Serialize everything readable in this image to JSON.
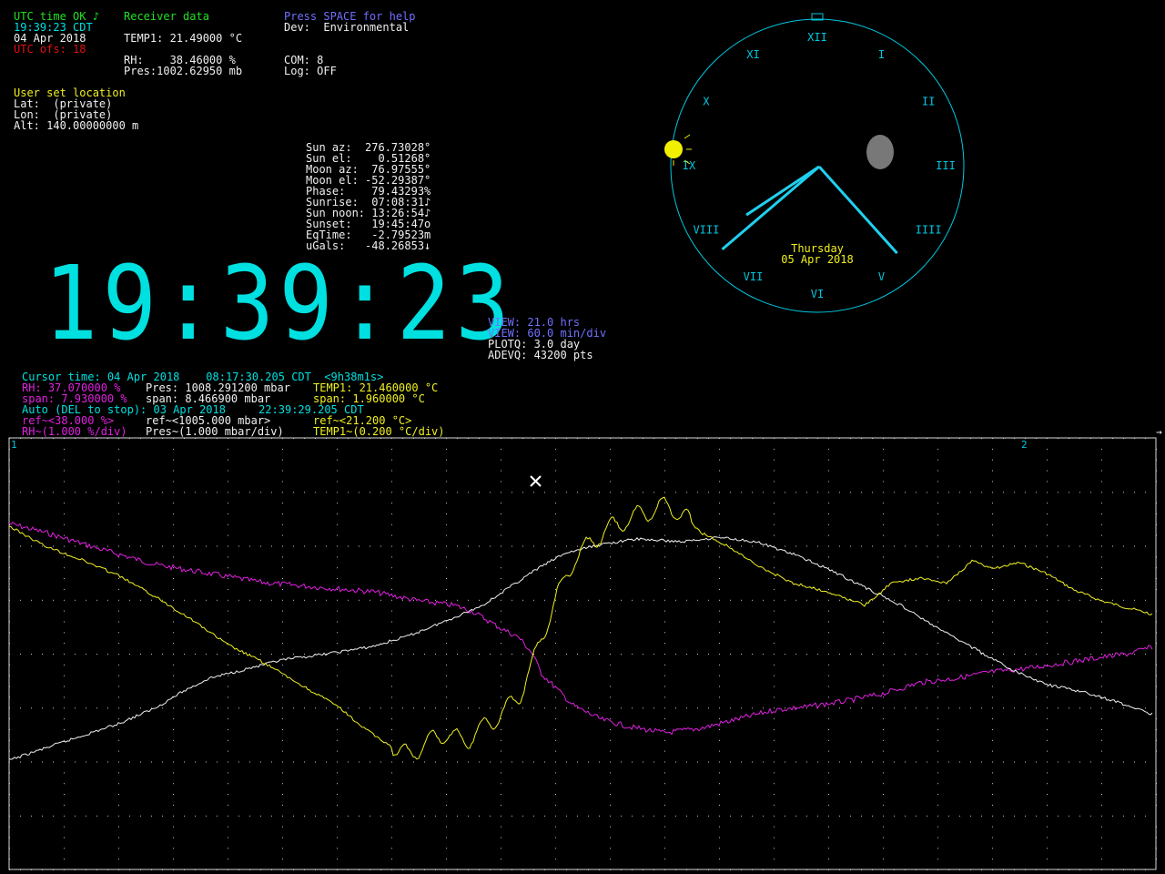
{
  "status": {
    "utc_line": "UTC time OK ♪",
    "time_line": "19:39:23 CDT",
    "date_line": "04 Apr 2018",
    "utc_ofs_line": "UTC ofs: 18"
  },
  "receiver": {
    "title": "Receiver data",
    "temp1": "TEMP1: 21.49000 °C",
    "rh": "RH:    38.46000 %",
    "pres": "Pres:1002.62950 mb"
  },
  "help": {
    "text": "Press SPACE for help"
  },
  "device": {
    "dev": "Dev:  Environmental",
    "com": "COM: 8",
    "log": "Log: OFF"
  },
  "location": {
    "title": "User set location",
    "lat": "Lat:  (private)",
    "lon": "Lon:  (private)",
    "alt": "Alt: 140.00000000 m"
  },
  "astro": [
    "Sun az:  276.73028°",
    "Sun el:    0.51268°",
    "Moon az:  76.97555°",
    "Moon el: -52.29387°",
    "Phase:    79.43293%",
    "Sunrise:  07:08:31♪",
    "Sun noon: 13:26:54♪",
    "Sunset:   19:45:47o",
    "EqTime:   -2.79523m",
    "uGals:   -48.26853↓"
  ],
  "big_clock": {
    "time": "19:39:23"
  },
  "clock": {
    "numerals": [
      "XII",
      "I",
      "II",
      "III",
      "IIII",
      "V",
      "VI",
      "VII",
      "VIII",
      "IX",
      "X",
      "XI"
    ],
    "day": "Thursday",
    "date": "05 Apr 2018",
    "hour_hand_value": 7.65,
    "minute_hand_value": 39.4,
    "second_hand_value": 23,
    "sun_icon": "sun-icon",
    "moon_icon": "moon-icon"
  },
  "view": {
    "view_hrs": "VIEW: 21.0 hrs",
    "view_div": "VIEW: 60.0 min/div",
    "plotq": "PLOTQ: 3.0 day",
    "adevq": "ADEVQ: 43200 pts"
  },
  "cursor": {
    "line1": "Cursor time: 04 Apr 2018    08:17:30.205 CDT  <9h38m1s>",
    "rh": "RH: 37.070000 %",
    "pres": "Pres: 1008.291200 mbar",
    "temp": "TEMP1: 21.460000 °C",
    "rh_span": "span: 7.930000 %",
    "pres_span": "span: 8.466900 mbar",
    "temp_span": "span: 1.960000 °C",
    "auto": "Auto (DEL to stop): 03 Apr 2018     22:39:29.205 CDT",
    "rh_ref": "ref~<38.000 %>",
    "pres_ref": "ref~<1005.000 mbar>",
    "temp_ref": "ref~<21.200 °C>",
    "rh_scale": "RH~(1.000 %/div)",
    "pres_scale": "Pres~(1.000 mbar/div)",
    "temp_scale": "TEMP1~(0.200 °C/div)"
  },
  "plot": {
    "marker_left": "1",
    "marker_right": "2",
    "colors": {
      "rh": "#e020e0",
      "pres": "#f0f0f0",
      "temp": "#f0f020",
      "grid": "#c8c8c8"
    },
    "series": [
      {
        "name": "RH",
        "color": "#e020e0",
        "points": [
          [
            0,
            575
          ],
          [
            40,
            585
          ],
          [
            100,
            603
          ],
          [
            160,
            620
          ],
          [
            220,
            630
          ],
          [
            280,
            640
          ],
          [
            340,
            645
          ],
          [
            400,
            650
          ],
          [
            450,
            660
          ],
          [
            490,
            665
          ],
          [
            510,
            672
          ],
          [
            540,
            690
          ],
          [
            560,
            700
          ],
          [
            575,
            718
          ],
          [
            585,
            740
          ],
          [
            600,
            755
          ],
          [
            620,
            775
          ],
          [
            650,
            790
          ],
          [
            680,
            798
          ],
          [
            720,
            805
          ],
          [
            760,
            800
          ],
          [
            800,
            790
          ],
          [
            840,
            780
          ],
          [
            880,
            776
          ],
          [
            920,
            770
          ],
          [
            960,
            762
          ],
          [
            1000,
            750
          ],
          [
            1040,
            745
          ],
          [
            1080,
            738
          ],
          [
            1120,
            734
          ],
          [
            1160,
            728
          ],
          [
            1200,
            722
          ],
          [
            1230,
            718
          ],
          [
            1258,
            710
          ]
        ]
      },
      {
        "name": "Pres",
        "color": "#f0f0f0",
        "points": [
          [
            0,
            835
          ],
          [
            60,
            815
          ],
          [
            120,
            795
          ],
          [
            160,
            778
          ],
          [
            190,
            760
          ],
          [
            220,
            745
          ],
          [
            260,
            735
          ],
          [
            300,
            725
          ],
          [
            350,
            718
          ],
          [
            400,
            710
          ],
          [
            440,
            698
          ],
          [
            480,
            682
          ],
          [
            520,
            665
          ],
          [
            550,
            645
          ],
          [
            580,
            625
          ],
          [
            610,
            608
          ],
          [
            650,
            598
          ],
          [
            690,
            592
          ],
          [
            740,
            595
          ],
          [
            780,
            590
          ],
          [
            820,
            595
          ],
          [
            860,
            608
          ],
          [
            900,
            625
          ],
          [
            940,
            645
          ],
          [
            980,
            665
          ],
          [
            1020,
            690
          ],
          [
            1060,
            712
          ],
          [
            1100,
            735
          ],
          [
            1140,
            752
          ],
          [
            1180,
            760
          ],
          [
            1220,
            772
          ],
          [
            1258,
            785
          ]
        ]
      },
      {
        "name": "TEMP1",
        "color": "#f0f020",
        "points": [
          [
            0,
            578
          ],
          [
            40,
            600
          ],
          [
            80,
            615
          ],
          [
            120,
            632
          ],
          [
            160,
            655
          ],
          [
            200,
            680
          ],
          [
            240,
            708
          ],
          [
            280,
            728
          ],
          [
            320,
            752
          ],
          [
            360,
            775
          ],
          [
            390,
            800
          ],
          [
            420,
            820
          ],
          [
            440,
            830
          ],
          [
            460,
            815
          ],
          [
            480,
            805
          ],
          [
            500,
            815
          ],
          [
            520,
            800
          ],
          [
            540,
            785
          ],
          [
            560,
            765
          ],
          [
            575,
            730
          ],
          [
            585,
            700
          ],
          [
            600,
            660
          ],
          [
            620,
            615
          ],
          [
            640,
            595
          ],
          [
            660,
            580
          ],
          [
            680,
            570
          ],
          [
            700,
            563
          ],
          [
            720,
            555
          ],
          [
            740,
            565
          ],
          [
            760,
            585
          ],
          [
            790,
            600
          ],
          [
            820,
            620
          ],
          [
            860,
            640
          ],
          [
            900,
            650
          ],
          [
            940,
            665
          ],
          [
            970,
            640
          ],
          [
            1000,
            635
          ],
          [
            1030,
            640
          ],
          [
            1060,
            615
          ],
          [
            1080,
            625
          ],
          [
            1110,
            618
          ],
          [
            1140,
            630
          ],
          [
            1170,
            648
          ],
          [
            1200,
            660
          ],
          [
            1230,
            668
          ],
          [
            1258,
            675
          ]
        ]
      }
    ]
  }
}
